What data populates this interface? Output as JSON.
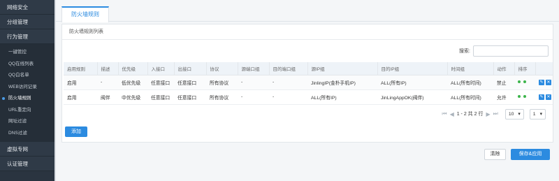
{
  "sidebar": {
    "groups_top": [
      "网络安全",
      "分组管理",
      "行为管理"
    ],
    "sub_items": [
      "一键管控",
      "QQ在线列表",
      "QQ白名单",
      "WEB访问记录",
      "防火墙规则",
      "URL重定向",
      "网址过滤",
      "DNS过滤"
    ],
    "groups_bottom": [
      "虚拟专网",
      "认证管理"
    ]
  },
  "tab": {
    "label": "防火墙规则"
  },
  "panel": {
    "title": "防火墙规则列表",
    "search_label": "搜索:",
    "columns": [
      "启用规则",
      "描述",
      "优先级",
      "入接口",
      "出接口",
      "协议",
      "源端口组",
      "目的端口组",
      "源IP组",
      "目的IP组",
      "时间组",
      "动作",
      "排序"
    ],
    "rows": [
      {
        "enabled": "启用",
        "desc": "-",
        "priority": "低优先级",
        "in_if": "任意接口",
        "out_if": "任意接口",
        "proto": "所有协议",
        "src_port": "-",
        "dst_port": "-",
        "src_ip": "JinlingIP(金朴手机IP)",
        "dst_ip": "ALL(所有IP)",
        "time": "ALL(所有时间)",
        "action": "禁止"
      },
      {
        "enabled": "启用",
        "desc": "阀伴",
        "priority": "中优先级",
        "in_if": "任意接口",
        "out_if": "任意接口",
        "proto": "所有协议",
        "src_port": "-",
        "dst_port": "-",
        "src_ip": "ALL(所有IP)",
        "dst_ip": "JinLingAppOK(阀伴)",
        "time": "ALL(所有时间)",
        "action": "允许"
      }
    ],
    "pager_text": "1 - 2 共 2 行",
    "page_size": "10",
    "page_num": "1",
    "add_label": "添加"
  },
  "footer": {
    "clear_label": "清除",
    "save_label": "保存&应用"
  },
  "colors": {
    "accent": "#2c8be0",
    "sidebar_bg": "#2a3440",
    "status_green": "#3cb44b"
  }
}
